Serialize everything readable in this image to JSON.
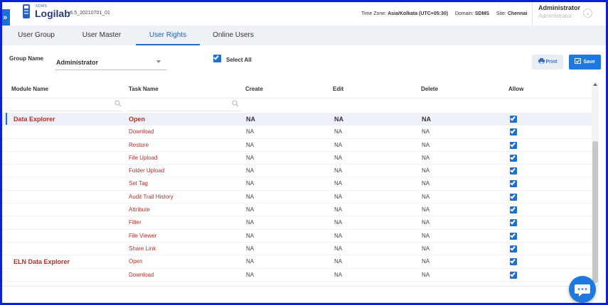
{
  "header": {
    "logo_small": "SDMS",
    "logo": "Logilab",
    "version": "v6.5_20210701_01",
    "timezone_label": "Time Zone:",
    "timezone_value": "Asia/Kolkata (UTC+05:30)",
    "domain_label": "Domain:",
    "domain_value": "SDMS",
    "site_label": "Site:",
    "site_value": "Chennai",
    "user_name": "Administrator",
    "user_role": "Administrator"
  },
  "tabs": [
    {
      "label": "User Group"
    },
    {
      "label": "User Master"
    },
    {
      "label": "User Rights"
    },
    {
      "label": "Online Users"
    }
  ],
  "form": {
    "group_name_label": "Group Name",
    "group_name_value": "Administrator",
    "select_all_label": "Select All",
    "select_all_checked": true,
    "print_label": "Print",
    "save_label": "Save"
  },
  "grid": {
    "columns": [
      "Module Name",
      "Task Name",
      "Create",
      "Edit",
      "Delete",
      "Allow"
    ],
    "rows": [
      {
        "module": "Data Explorer",
        "task": "Open",
        "create": "NA",
        "edit": "NA",
        "delete": "NA",
        "allow": true,
        "selected": true
      },
      {
        "module": "",
        "task": "Download",
        "create": "NA",
        "edit": "NA",
        "delete": "NA",
        "allow": true
      },
      {
        "module": "",
        "task": "Restore",
        "create": "NA",
        "edit": "NA",
        "delete": "NA",
        "allow": true
      },
      {
        "module": "",
        "task": "File Upload",
        "create": "NA",
        "edit": "NA",
        "delete": "NA",
        "allow": true
      },
      {
        "module": "",
        "task": "Folder Upload",
        "create": "NA",
        "edit": "NA",
        "delete": "NA",
        "allow": true
      },
      {
        "module": "",
        "task": "Set Tag",
        "create": "NA",
        "edit": "NA",
        "delete": "NA",
        "allow": true
      },
      {
        "module": "",
        "task": "Audit Trail History",
        "create": "NA",
        "edit": "NA",
        "delete": "NA",
        "allow": true
      },
      {
        "module": "",
        "task": "Attribute",
        "create": "NA",
        "edit": "NA",
        "delete": "NA",
        "allow": true
      },
      {
        "module": "",
        "task": "Filter",
        "create": "NA",
        "edit": "NA",
        "delete": "NA",
        "allow": true
      },
      {
        "module": "",
        "task": "File Viewer",
        "create": "NA",
        "edit": "NA",
        "delete": "NA",
        "allow": true
      },
      {
        "module": "",
        "task": "Share Link",
        "create": "NA",
        "edit": "NA",
        "delete": "NA",
        "allow": true
      },
      {
        "module": "ELN Data Explorer",
        "task": "Open",
        "create": "NA",
        "edit": "NA",
        "delete": "NA",
        "allow": true
      },
      {
        "module": "",
        "task": "Download",
        "create": "NA",
        "edit": "NA",
        "delete": "NA",
        "allow": true
      }
    ]
  },
  "colors": {
    "accent": "#1f6fd1",
    "module_text": "#b2302b",
    "frame_border": "#0a1fd6"
  }
}
